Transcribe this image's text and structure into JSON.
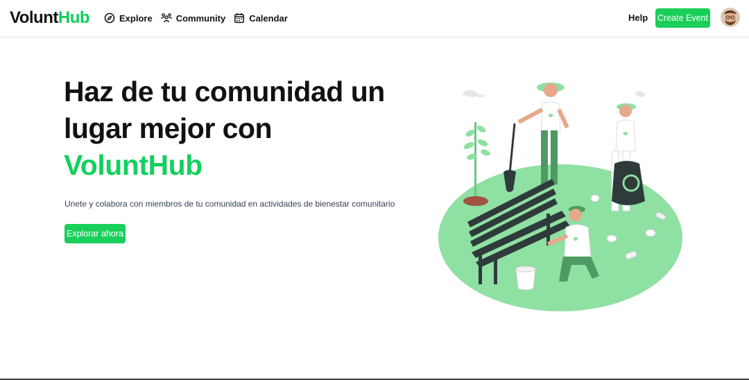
{
  "header": {
    "logo_part1": "Volunt",
    "logo_part2": "Hub",
    "nav": [
      {
        "label": "Explore",
        "icon": "compass-icon"
      },
      {
        "label": "Community",
        "icon": "community-icon"
      },
      {
        "label": "Calendar",
        "icon": "calendar-icon"
      }
    ],
    "help_label": "Help",
    "create_label": "Create Event"
  },
  "hero": {
    "title_line1": "Haz de tu comunidad un",
    "title_line2": "lugar mejor con",
    "title_accent": "VoluntHub",
    "subtitle": "Unete y colabora con miembros de tu comunidad en actividades de bienestar comunitario",
    "cta_label": "Explorar ahora"
  },
  "colors": {
    "accent": "#19cf5a",
    "illustration_green": "#8fe0a3"
  }
}
